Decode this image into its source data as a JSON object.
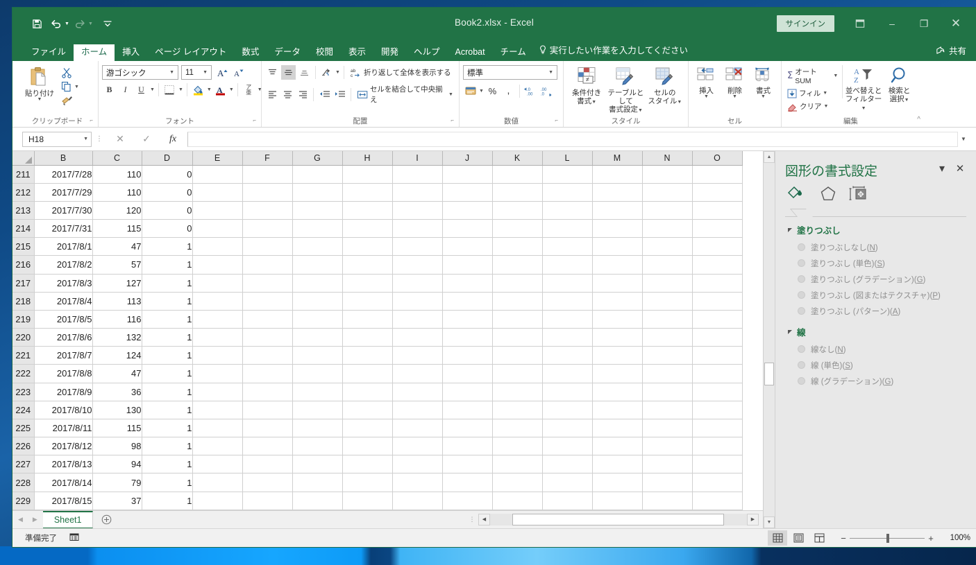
{
  "window": {
    "title": "Book2.xlsx  -  Excel",
    "signin_label": "サインイン",
    "ribbon_display_icon": "ribbon-display-options-icon",
    "minimize_icon": "–",
    "restore_icon": "❐",
    "close_icon": "✕"
  },
  "qat": {
    "save_icon": "save-icon",
    "undo_icon": "↺",
    "redo_icon": "↻",
    "customize_icon": "▾"
  },
  "tabs": [
    {
      "label": "ファイル",
      "active": false
    },
    {
      "label": "ホーム",
      "active": true
    },
    {
      "label": "挿入",
      "active": false
    },
    {
      "label": "ページ レイアウト",
      "active": false
    },
    {
      "label": "数式",
      "active": false
    },
    {
      "label": "データ",
      "active": false
    },
    {
      "label": "校閲",
      "active": false
    },
    {
      "label": "表示",
      "active": false
    },
    {
      "label": "開発",
      "active": false
    },
    {
      "label": "ヘルプ",
      "active": false
    },
    {
      "label": "Acrobat",
      "active": false
    },
    {
      "label": "チーム",
      "active": false
    }
  ],
  "tell_me": "実行したい作業を入力してください",
  "share_label": "共有",
  "ribbon": {
    "clipboard": {
      "group_label": "クリップボード",
      "paste_label": "貼り付け",
      "cut_label": "cut-icon",
      "copy_label": "copy-icon",
      "format_painter_label": "format-painter-icon"
    },
    "font": {
      "group_label": "フォント",
      "font_name": "游ゴシック",
      "font_size": "11",
      "grow_font": "A",
      "shrink_font": "A",
      "bold": "B",
      "italic": "I",
      "underline": "U",
      "borders": "borders-icon",
      "fill_color": "fill-color-icon",
      "font_color": "A",
      "phonetic": "ア亜"
    },
    "alignment": {
      "group_label": "配置",
      "align_top": "align-top-icon",
      "align_middle": "align-middle-icon",
      "align_bottom": "align-bottom-icon",
      "orientation": "orientation-icon",
      "wrap_text": "折り返して全体を表示する",
      "align_left": "align-left-icon",
      "align_center": "align-center-icon",
      "align_right": "align-right-icon",
      "decrease_indent": "decrease-indent-icon",
      "increase_indent": "increase-indent-icon",
      "merge_center": "セルを結合して中央揃え"
    },
    "number": {
      "group_label": "数値",
      "format": "標準",
      "accounting": "accounting-icon",
      "percent": "%",
      "comma": ",",
      "increase_decimal": ".00",
      "decrease_decimal": ".0"
    },
    "styles": {
      "group_label": "スタイル",
      "conditional_formatting": "条件付き\n書式",
      "conditional_formatting_l1": "条件付き",
      "conditional_formatting_l2": "書式",
      "format_as_table_l1": "テーブルとして",
      "format_as_table_l2": "書式設定",
      "cell_styles_l1": "セルの",
      "cell_styles_l2": "スタイル"
    },
    "cells": {
      "group_label": "セル",
      "insert": "挿入",
      "delete": "削除",
      "format": "書式"
    },
    "editing": {
      "group_label": "編集",
      "autosum": "オート SUM",
      "fill": "フィル",
      "clear": "クリア",
      "sort_filter_l1": "並べ替えと",
      "sort_filter_l2": "フィルター",
      "find_select_l1": "検索と",
      "find_select_l2": "選択",
      "collapse_ribbon": "^"
    }
  },
  "formula_bar": {
    "name_box": "H18",
    "cancel_icon": "✕",
    "enter_icon": "✓",
    "function_icon": "fx",
    "value": ""
  },
  "grid": {
    "columns": [
      "B",
      "C",
      "D",
      "E",
      "F",
      "G",
      "H",
      "I",
      "J",
      "K",
      "L",
      "M",
      "N",
      "O"
    ],
    "rows": [
      {
        "n": "211",
        "B": "2017/7/28",
        "C": "110",
        "D": "0"
      },
      {
        "n": "212",
        "B": "2017/7/29",
        "C": "110",
        "D": "0"
      },
      {
        "n": "213",
        "B": "2017/7/30",
        "C": "120",
        "D": "0"
      },
      {
        "n": "214",
        "B": "2017/7/31",
        "C": "115",
        "D": "0"
      },
      {
        "n": "215",
        "B": "2017/8/1",
        "C": "47",
        "D": "1"
      },
      {
        "n": "216",
        "B": "2017/8/2",
        "C": "57",
        "D": "1"
      },
      {
        "n": "217",
        "B": "2017/8/3",
        "C": "127",
        "D": "1"
      },
      {
        "n": "218",
        "B": "2017/8/4",
        "C": "113",
        "D": "1"
      },
      {
        "n": "219",
        "B": "2017/8/5",
        "C": "116",
        "D": "1"
      },
      {
        "n": "220",
        "B": "2017/8/6",
        "C": "132",
        "D": "1"
      },
      {
        "n": "221",
        "B": "2017/8/7",
        "C": "124",
        "D": "1"
      },
      {
        "n": "222",
        "B": "2017/8/8",
        "C": "47",
        "D": "1"
      },
      {
        "n": "223",
        "B": "2017/8/9",
        "C": "36",
        "D": "1"
      },
      {
        "n": "224",
        "B": "2017/8/10",
        "C": "130",
        "D": "1"
      },
      {
        "n": "225",
        "B": "2017/8/11",
        "C": "115",
        "D": "1"
      },
      {
        "n": "226",
        "B": "2017/8/12",
        "C": "98",
        "D": "1"
      },
      {
        "n": "227",
        "B": "2017/8/13",
        "C": "94",
        "D": "1"
      },
      {
        "n": "228",
        "B": "2017/8/14",
        "C": "79",
        "D": "1"
      },
      {
        "n": "229",
        "B": "2017/8/15",
        "C": "37",
        "D": "1"
      }
    ]
  },
  "sheet_tabs": {
    "first_icon": "◀",
    "prev_icon": "▶",
    "sheets": [
      "Sheet1"
    ],
    "add_label": "＋"
  },
  "task_pane": {
    "title": "図形の書式設定",
    "menu_icon": "▾",
    "close_icon": "✕",
    "icon_fill": "fill-and-line-icon",
    "icon_effects": "effects-icon",
    "icon_size": "size-properties-icon",
    "sections": [
      {
        "heading": "塗りつぶし",
        "options": [
          {
            "pre": "塗りつぶしなし(",
            "key": "N",
            "post": ")"
          },
          {
            "pre": "塗りつぶし (単色)(",
            "key": "S",
            "post": ")"
          },
          {
            "pre": "塗りつぶし (グラデーション)(",
            "key": "G",
            "post": ")"
          },
          {
            "pre": "塗りつぶし (図またはテクスチャ)(",
            "key": "P",
            "post": ")"
          },
          {
            "pre": "塗りつぶし (パターン)(",
            "key": "A",
            "post": ")"
          }
        ]
      },
      {
        "heading": "線",
        "options": [
          {
            "pre": "線なし(",
            "key": "N",
            "post": ")"
          },
          {
            "pre": "線 (単色)(",
            "key": "S",
            "post": ")"
          },
          {
            "pre": "線 (グラデーション)(",
            "key": "G",
            "post": ")"
          }
        ]
      }
    ]
  },
  "status_bar": {
    "text": "準備完了",
    "icon": "accessibility-icon",
    "view_normal": "normal-view-icon",
    "view_layout": "page-layout-view-icon",
    "view_break": "page-break-view-icon",
    "zoom_out": "−",
    "zoom_in": "+",
    "zoom_level": "100%"
  },
  "colors": {
    "excel_green": "#217346",
    "accent_blue": "#1f6fb5"
  }
}
